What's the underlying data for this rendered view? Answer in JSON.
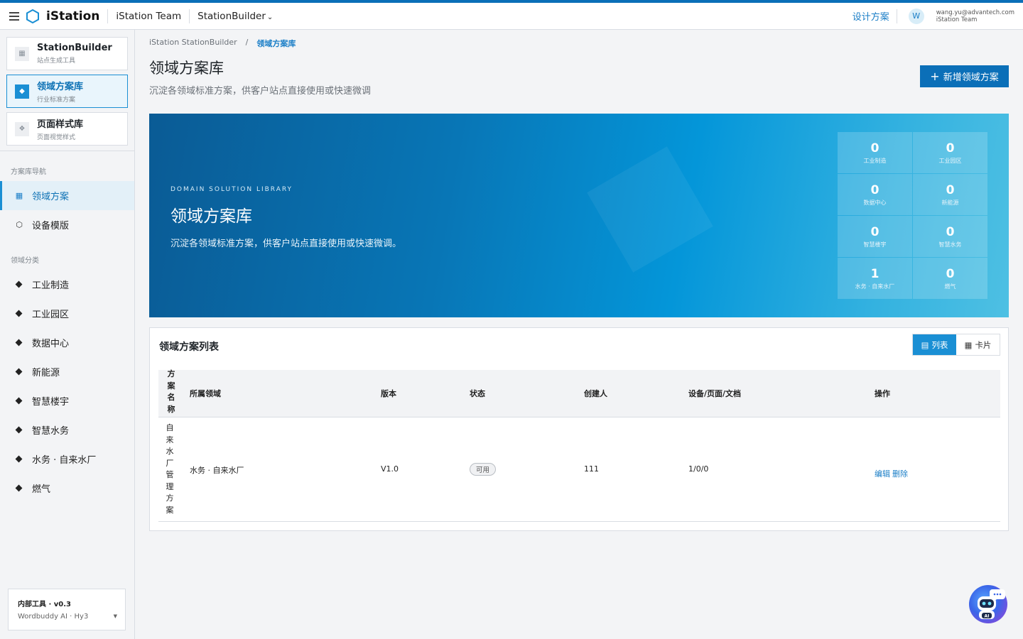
{
  "topbar": {
    "brand": "iStation",
    "team": "iStation Team",
    "product": "StationBuilder",
    "design_link": "设计方案",
    "avatar_letter": "W",
    "user_email": "wang.yu@advantech.com",
    "user_team": "iStation Team"
  },
  "sidebar": {
    "apps": [
      {
        "title": "StationBuilder",
        "subtitle": "站点生成工具"
      },
      {
        "title": "领域方案库",
        "subtitle": "行业标准方案"
      },
      {
        "title": "页面样式库",
        "subtitle": "页面视觉样式"
      }
    ],
    "nav_section": "方案库导航",
    "nav_items": [
      {
        "label": "领域方案",
        "icon": "grid-icon"
      },
      {
        "label": "设备模版",
        "icon": "hexagon-icon"
      }
    ],
    "category_section": "领域分类",
    "categories": [
      "工业制造",
      "工业园区",
      "数据中心",
      "新能源",
      "智慧楼宇",
      "智慧水务",
      "水务 · 自来水厂",
      "燃气"
    ],
    "tool": {
      "title": "内部工具 · v0.3",
      "model": "Wordbuddy AI · Hy3"
    }
  },
  "main": {
    "breadcrumb": [
      "iStation StationBuilder",
      "/",
      "领域方案库"
    ],
    "title": "领域方案库",
    "subtitle": "沉淀各领域标准方案，供客户站点直接使用或快速微调",
    "new_button": "新增领域方案"
  },
  "hero": {
    "eyebrow": "DOMAIN SOLUTION LIBRARY",
    "title": "领域方案库",
    "subtitle": "沉淀各领域标准方案，供客户站点直接使用或快速微调。",
    "stats": [
      {
        "value": "0",
        "label": "工业制造"
      },
      {
        "value": "0",
        "label": "工业园区"
      },
      {
        "value": "0",
        "label": "数据中心"
      },
      {
        "value": "0",
        "label": "新能源"
      },
      {
        "value": "0",
        "label": "智慧楼宇"
      },
      {
        "value": "0",
        "label": "智慧水务"
      },
      {
        "value": "1",
        "label": "水务 · 自来水厂"
      },
      {
        "value": "0",
        "label": "燃气"
      }
    ]
  },
  "list": {
    "title": "领域方案列表",
    "view_list": "列表",
    "view_card": "卡片",
    "columns": [
      "方案名称",
      "所属领域",
      "版本",
      "状态",
      "创建人",
      "设备/页面/文档",
      "操作"
    ],
    "rows": [
      {
        "name": "自来水厂管理方案",
        "domain": "水务 · 自来水厂",
        "version": "V1.0",
        "status": "可用",
        "creator": "111",
        "counts": "1/0/0",
        "edit": "编辑",
        "delete": "删除"
      }
    ]
  },
  "colors": {
    "accent": "#0b6fb8",
    "link": "#1a7ec7",
    "active_bg": "#e3f0f8"
  }
}
